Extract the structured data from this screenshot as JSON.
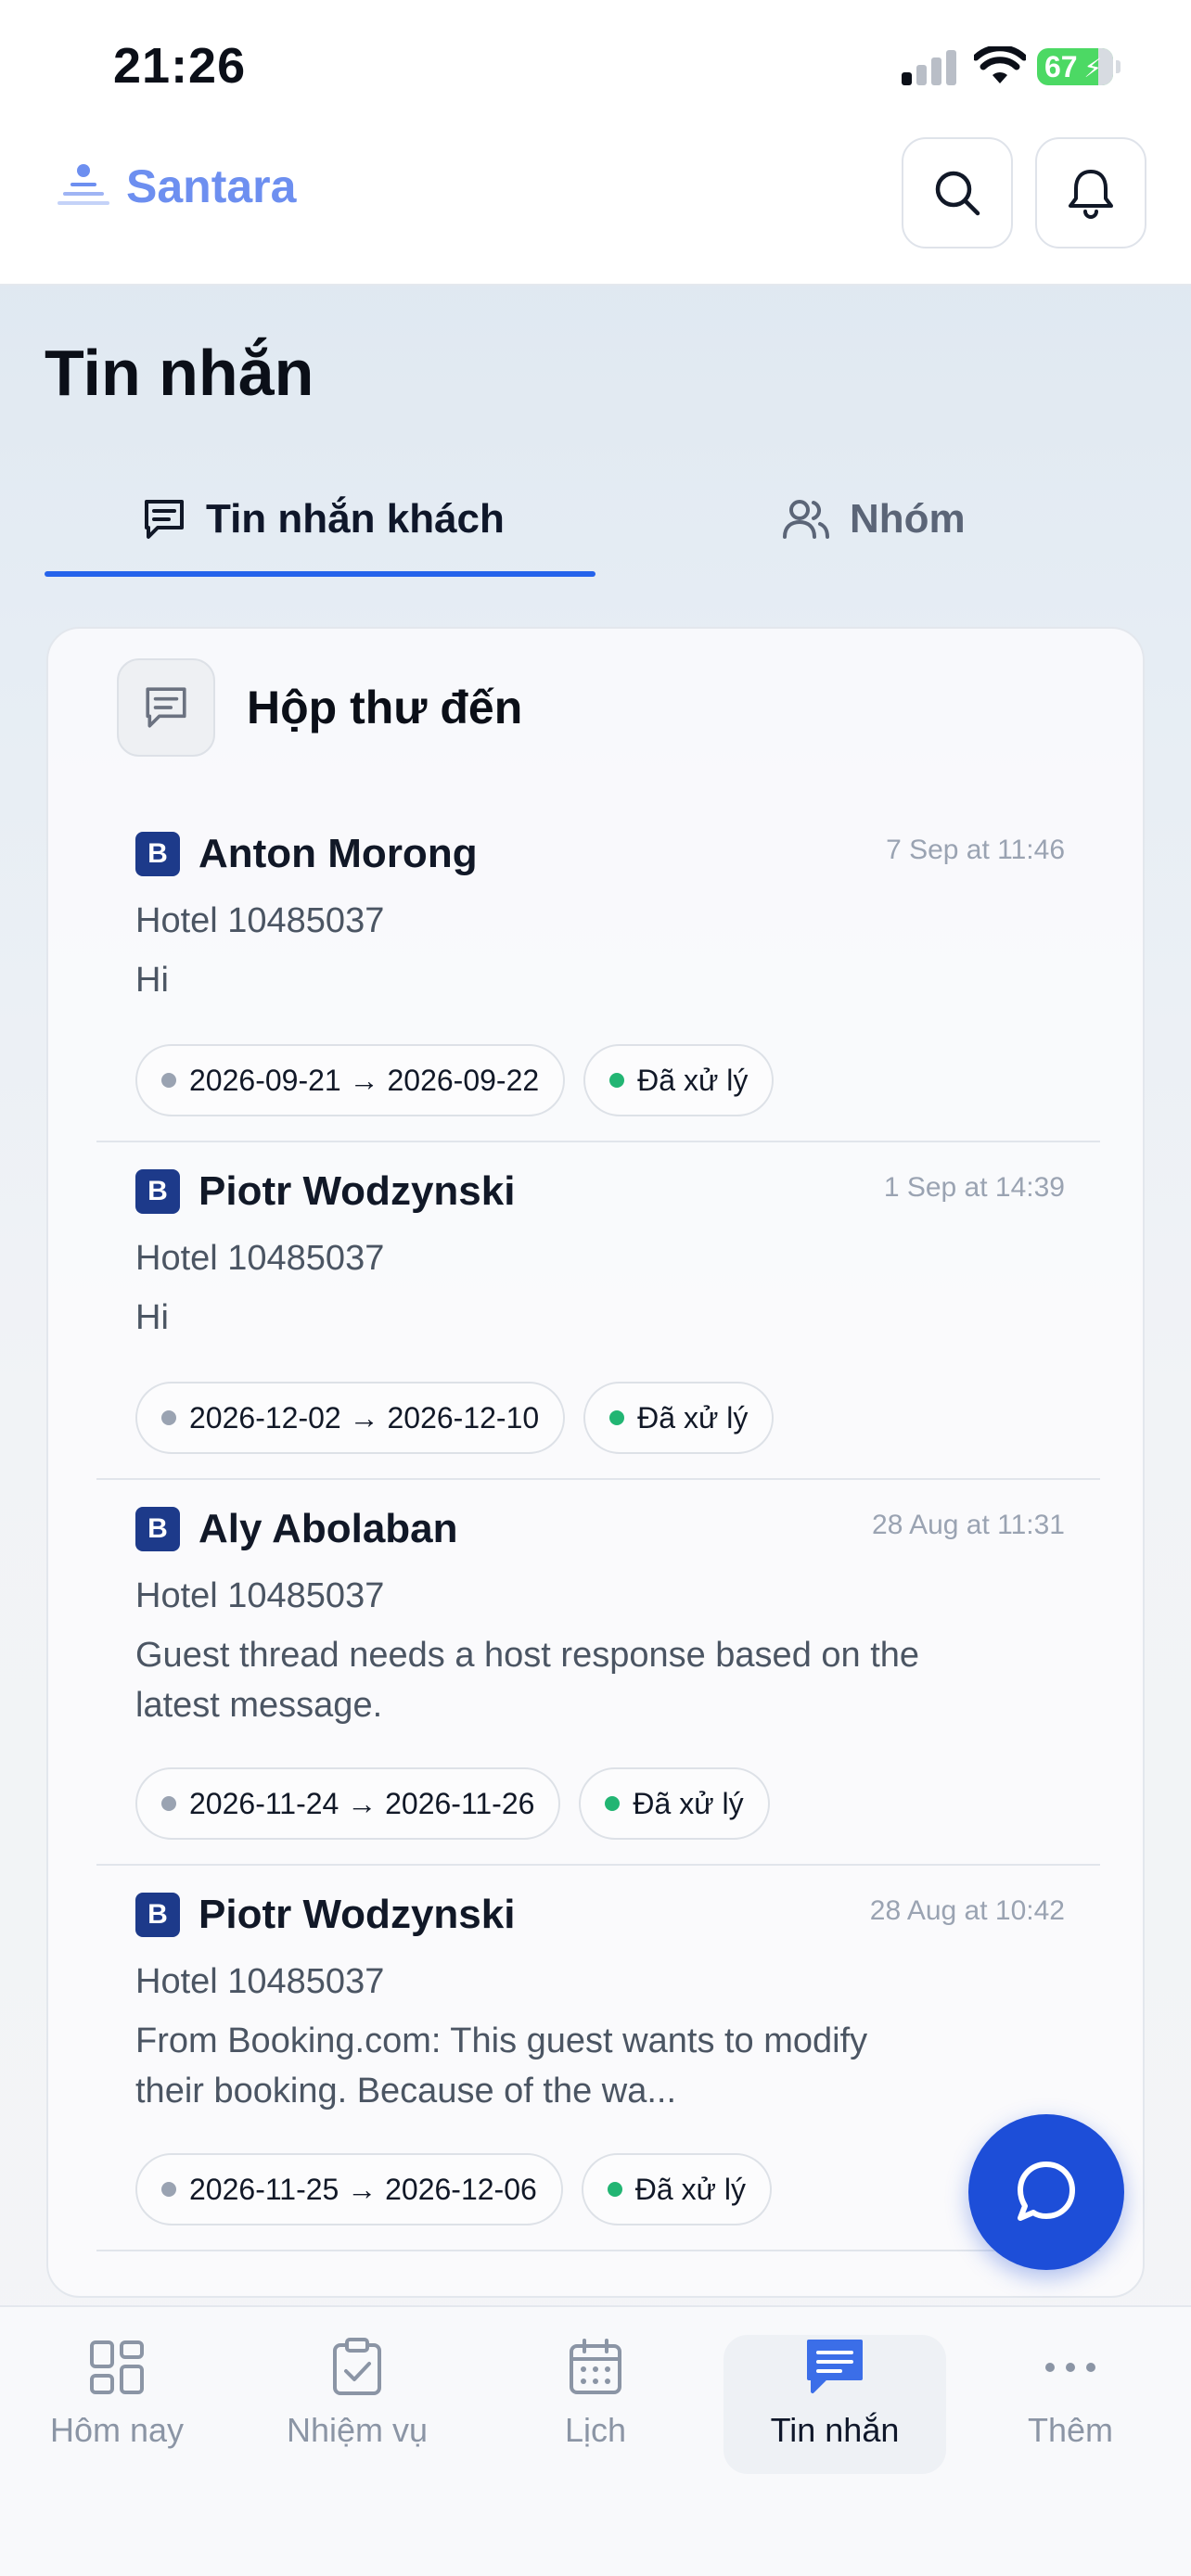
{
  "status_bar": {
    "time": "21:26",
    "battery": "67"
  },
  "header": {
    "brand": "Santara",
    "brand_color": "#6d8ff0",
    "search_icon": "search-icon",
    "bell_icon": "bell-icon"
  },
  "page": {
    "title": "Tin nhắn"
  },
  "tabs": [
    {
      "label": "Tin nhắn khách",
      "icon": "message-square-icon",
      "active": true
    },
    {
      "label": "Nhóm",
      "icon": "users-icon",
      "active": false
    }
  ],
  "inbox": {
    "title": "Hộp thư đến",
    "messages": [
      {
        "source_badge": "B",
        "name": "Anton Morong",
        "time": "7 Sep at 11:46",
        "hotel": "Hotel 10485037",
        "text": "Hi",
        "dates": "2026-09-21 → 2026-09-22",
        "status": "Đã xử lý"
      },
      {
        "source_badge": "B",
        "name": "Piotr Wodzynski",
        "time": "1 Sep at 14:39",
        "hotel": "Hotel 10485037",
        "text": "Hi",
        "dates": "2026-12-02 → 2026-12-10",
        "status": "Đã xử lý"
      },
      {
        "source_badge": "B",
        "name": "Aly Abolaban",
        "time": "28 Aug at 11:31",
        "hotel": "Hotel 10485037",
        "text": "Guest thread needs a host response based on the latest message.",
        "dates": "2026-11-24 → 2026-11-26",
        "status": "Đã xử lý"
      },
      {
        "source_badge": "B",
        "name": "Piotr Wodzynski",
        "time": "28 Aug at 10:42",
        "hotel": "Hotel 10485037",
        "text": "From Booking.com: This guest wants to modify their booking. Because of the wa...",
        "dates": "2026-11-25 → 2026-12-06",
        "status": "Đã xử lý"
      }
    ]
  },
  "bottom_nav": [
    {
      "label": "Hôm nay",
      "icon": "dashboard-icon",
      "active": false
    },
    {
      "label": "Nhiệm vụ",
      "icon": "clipboard-check-icon",
      "active": false
    },
    {
      "label": "Lịch",
      "icon": "calendar-icon",
      "active": false
    },
    {
      "label": "Tin nhắn",
      "icon": "message-icon",
      "active": true
    },
    {
      "label": "Thêm",
      "icon": "more-icon",
      "active": false
    }
  ],
  "colors": {
    "accent": "#2563eb",
    "status_green": "#22b573",
    "fab": "#1d4ed8",
    "booking_badge": "#1d3a8a"
  }
}
